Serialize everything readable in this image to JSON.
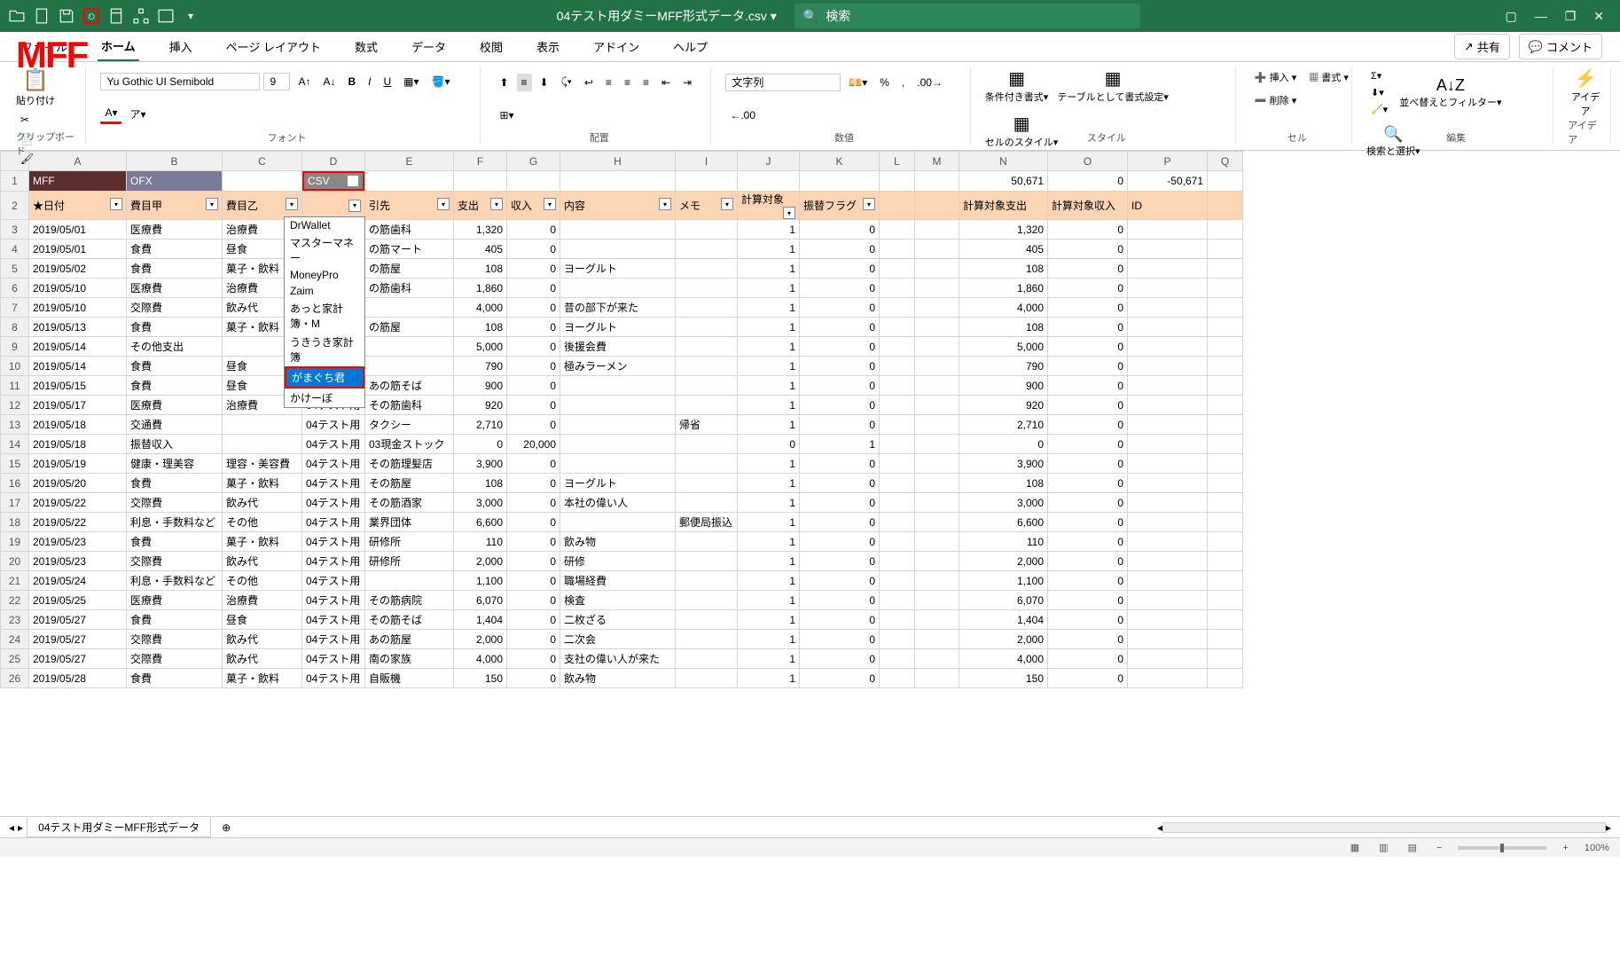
{
  "title": {
    "filename": "04テスト用ダミーMFF形式データ.csv",
    "search_placeholder": "検索"
  },
  "overlay": "MFF",
  "ribbon_tabs": [
    "ファイル",
    "ホーム",
    "挿入",
    "ページ レイアウト",
    "数式",
    "データ",
    "校閲",
    "表示",
    "アドイン",
    "ヘルプ"
  ],
  "ribbon_right": {
    "share": "共有",
    "comment": "コメント"
  },
  "font": {
    "name": "Yu Gothic UI Semibold",
    "size": "9"
  },
  "number_format": "文字列",
  "ribbon_groups": {
    "clipboard": "クリップボード",
    "paste": "貼り付け",
    "font": "フォント",
    "align": "配置",
    "number": "数値",
    "style": "スタイル",
    "cells": "セル",
    "edit": "編集",
    "idea": "アイデア",
    "cond_format": "条件付き書式",
    "as_table": "テーブルとして書式設定",
    "cell_style": "セルのスタイル",
    "insert": "挿入",
    "delete": "削除",
    "format": "書式",
    "sort_filter": "並べ替えとフィルター",
    "find_select": "検索と選択",
    "ai": "アイデア"
  },
  "columns": [
    "A",
    "B",
    "C",
    "D",
    "E",
    "F",
    "G",
    "H",
    "I",
    "J",
    "K",
    "L",
    "M",
    "N",
    "O",
    "P",
    "Q"
  ],
  "row1": {
    "A": "MFF",
    "B": "OFX",
    "D": "CSV",
    "N": "50,671",
    "O": "0",
    "P": "-50,671"
  },
  "headers": {
    "A": "★日付",
    "B": "費目甲",
    "C": "費目乙",
    "E": "引先",
    "F": "支出",
    "G": "収入",
    "H": "内容",
    "I": "メモ",
    "J": "計算対象",
    "K": "振替フラグ",
    "N": "計算対象支出",
    "O": "計算対象収入",
    "P": "ID"
  },
  "dropdown": {
    "options": [
      "DrWallet",
      "マスターマネー",
      "MoneyPro",
      "Zaim",
      "あっと家計簿・M",
      "うきうき家計簿",
      "がまぐち君",
      "かけーぼ"
    ],
    "selected_index": 6
  },
  "rows": [
    {
      "n": 3,
      "d": [
        "2019/05/01",
        "医療費",
        "治療費",
        "",
        "の筋歯科",
        "1,320",
        "0",
        "",
        "",
        "1",
        "0",
        "",
        "",
        "1,320",
        "0"
      ]
    },
    {
      "n": 4,
      "d": [
        "2019/05/01",
        "食費",
        "昼食",
        "",
        "の筋マート",
        "405",
        "0",
        "",
        "",
        "1",
        "0",
        "",
        "",
        "405",
        "0"
      ]
    },
    {
      "n": 5,
      "d": [
        "2019/05/02",
        "食費",
        "菓子・飲料",
        "",
        "の筋屋",
        "108",
        "0",
        "ヨーグルト",
        "",
        "1",
        "0",
        "",
        "",
        "108",
        "0"
      ]
    },
    {
      "n": 6,
      "d": [
        "2019/05/10",
        "医療費",
        "治療費",
        "",
        "の筋歯科",
        "1,860",
        "0",
        "",
        "",
        "1",
        "0",
        "",
        "",
        "1,860",
        "0"
      ]
    },
    {
      "n": 7,
      "d": [
        "2019/05/10",
        "交際費",
        "飲み代",
        "",
        "",
        "4,000",
        "0",
        "昔の部下が来た",
        "",
        "1",
        "0",
        "",
        "",
        "4,000",
        "0"
      ]
    },
    {
      "n": 8,
      "d": [
        "2019/05/13",
        "食費",
        "菓子・飲料",
        "",
        "の筋屋",
        "108",
        "0",
        "ヨーグルト",
        "",
        "1",
        "0",
        "",
        "",
        "108",
        "0"
      ]
    },
    {
      "n": 9,
      "d": [
        "2019/05/14",
        "その他支出",
        "",
        "04テスト用",
        "",
        "5,000",
        "0",
        "後援会費",
        "",
        "1",
        "0",
        "",
        "",
        "5,000",
        "0"
      ]
    },
    {
      "n": 10,
      "d": [
        "2019/05/14",
        "食費",
        "昼食",
        "04テスト用",
        "",
        "790",
        "0",
        "極みラーメン",
        "",
        "1",
        "0",
        "",
        "",
        "790",
        "0"
      ]
    },
    {
      "n": 11,
      "d": [
        "2019/05/15",
        "食費",
        "昼食",
        "04テスト用",
        "あの筋そば",
        "900",
        "0",
        "",
        "",
        "1",
        "0",
        "",
        "",
        "900",
        "0"
      ]
    },
    {
      "n": 12,
      "d": [
        "2019/05/17",
        "医療費",
        "治療費",
        "04テスト用",
        "その筋歯科",
        "920",
        "0",
        "",
        "",
        "1",
        "0",
        "",
        "",
        "920",
        "0"
      ]
    },
    {
      "n": 13,
      "d": [
        "2019/05/18",
        "交通費",
        "",
        "04テスト用",
        "タクシー",
        "2,710",
        "0",
        "",
        "帰省",
        "1",
        "0",
        "",
        "",
        "2,710",
        "0"
      ]
    },
    {
      "n": 14,
      "d": [
        "2019/05/18",
        "振替収入",
        "",
        "04テスト用",
        "03現金ストック",
        "0",
        "20,000",
        "",
        "",
        "0",
        "1",
        "",
        "",
        "0",
        "0"
      ]
    },
    {
      "n": 15,
      "d": [
        "2019/05/19",
        "健康・理美容",
        "理容・美容費",
        "04テスト用",
        "その筋理髪店",
        "3,900",
        "0",
        "",
        "",
        "1",
        "0",
        "",
        "",
        "3,900",
        "0"
      ]
    },
    {
      "n": 16,
      "d": [
        "2019/05/20",
        "食費",
        "菓子・飲料",
        "04テスト用",
        "その筋屋",
        "108",
        "0",
        "ヨーグルト",
        "",
        "1",
        "0",
        "",
        "",
        "108",
        "0"
      ]
    },
    {
      "n": 17,
      "d": [
        "2019/05/22",
        "交際費",
        "飲み代",
        "04テスト用",
        "その筋酒家",
        "3,000",
        "0",
        "本社の偉い人",
        "",
        "1",
        "0",
        "",
        "",
        "3,000",
        "0"
      ]
    },
    {
      "n": 18,
      "d": [
        "2019/05/22",
        "利息・手数料など",
        "その他",
        "04テスト用",
        "業界団体",
        "6,600",
        "0",
        "",
        "郵便局振込",
        "1",
        "0",
        "",
        "",
        "6,600",
        "0"
      ]
    },
    {
      "n": 19,
      "d": [
        "2019/05/23",
        "食費",
        "菓子・飲料",
        "04テスト用",
        "研修所",
        "110",
        "0",
        "飲み物",
        "",
        "1",
        "0",
        "",
        "",
        "110",
        "0"
      ]
    },
    {
      "n": 20,
      "d": [
        "2019/05/23",
        "交際費",
        "飲み代",
        "04テスト用",
        "研修所",
        "2,000",
        "0",
        "研修",
        "",
        "1",
        "0",
        "",
        "",
        "2,000",
        "0"
      ]
    },
    {
      "n": 21,
      "d": [
        "2019/05/24",
        "利息・手数料など",
        "その他",
        "04テスト用",
        "",
        "1,100",
        "0",
        "職場経費",
        "",
        "1",
        "0",
        "",
        "",
        "1,100",
        "0"
      ]
    },
    {
      "n": 22,
      "d": [
        "2019/05/25",
        "医療費",
        "治療費",
        "04テスト用",
        "その筋病院",
        "6,070",
        "0",
        "検査",
        "",
        "1",
        "0",
        "",
        "",
        "6,070",
        "0"
      ]
    },
    {
      "n": 23,
      "d": [
        "2019/05/27",
        "食費",
        "昼食",
        "04テスト用",
        "その筋そば",
        "1,404",
        "0",
        "二枚ざる",
        "",
        "1",
        "0",
        "",
        "",
        "1,404",
        "0"
      ]
    },
    {
      "n": 24,
      "d": [
        "2019/05/27",
        "交際費",
        "飲み代",
        "04テスト用",
        "あの筋屋",
        "2,000",
        "0",
        "二次会",
        "",
        "1",
        "0",
        "",
        "",
        "2,000",
        "0"
      ]
    },
    {
      "n": 25,
      "d": [
        "2019/05/27",
        "交際費",
        "飲み代",
        "04テスト用",
        "南の家族",
        "4,000",
        "0",
        "支社の偉い人が来た",
        "",
        "1",
        "0",
        "",
        "",
        "4,000",
        "0"
      ]
    },
    {
      "n": 26,
      "d": [
        "2019/05/28",
        "食費",
        "菓子・飲料",
        "04テスト用",
        "自販機",
        "150",
        "0",
        "飲み物",
        "",
        "1",
        "0",
        "",
        "",
        "150",
        "0"
      ]
    }
  ],
  "sheet_name": "04テスト用ダミーMFF形式データ",
  "zoom": "100%"
}
